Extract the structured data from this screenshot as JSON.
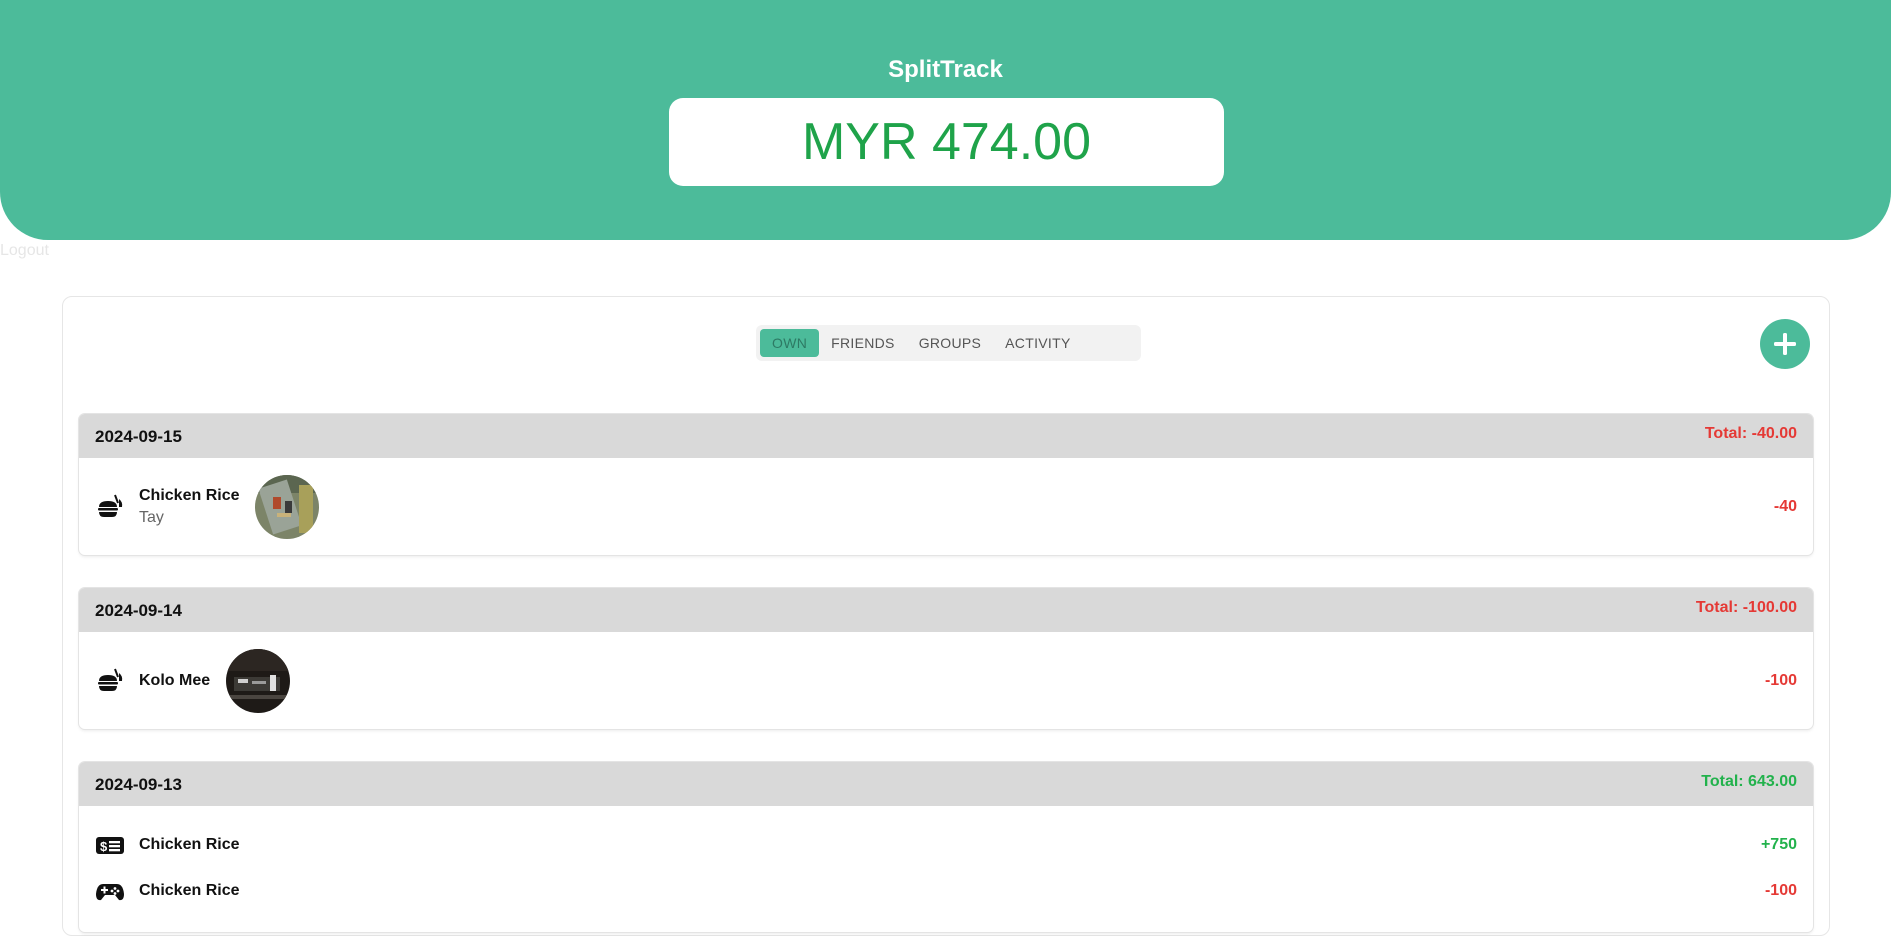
{
  "header": {
    "app_title": "SplitTrack",
    "balance": "MYR 474.00",
    "logout_label": "Logout"
  },
  "tabs": [
    {
      "label": "OWN",
      "active": true
    },
    {
      "label": "FRIENDS",
      "active": false
    },
    {
      "label": "GROUPS",
      "active": false
    },
    {
      "label": "ACTIVITY",
      "active": false
    }
  ],
  "add_button": {
    "icon": "plus-icon"
  },
  "groups": [
    {
      "date": "2024-09-15",
      "total": "Total: -40.00",
      "items": [
        {
          "icon": "food-icon",
          "title": "Chicken Rice",
          "subtitle": "Tay",
          "amount": "-40",
          "thumbnail": "photo"
        }
      ]
    },
    {
      "date": "2024-09-14",
      "total": "Total: -100.00",
      "items": [
        {
          "icon": "food-icon",
          "title": "Kolo Mee",
          "amount": "-100",
          "thumbnail": "photo"
        }
      ]
    },
    {
      "date": "2024-09-13",
      "total": "Total: 643.00",
      "items": [
        {
          "icon": "money-bill-icon",
          "title": "Chicken Rice",
          "amount": "+750"
        },
        {
          "icon": "gamepad-icon",
          "title": "Chicken Rice",
          "amount": "-100"
        }
      ]
    }
  ],
  "colors": {
    "brand": "#4cbb9a",
    "balance_text": "#1fa34a",
    "negative": "#e53935",
    "positive": "#22b24c"
  }
}
